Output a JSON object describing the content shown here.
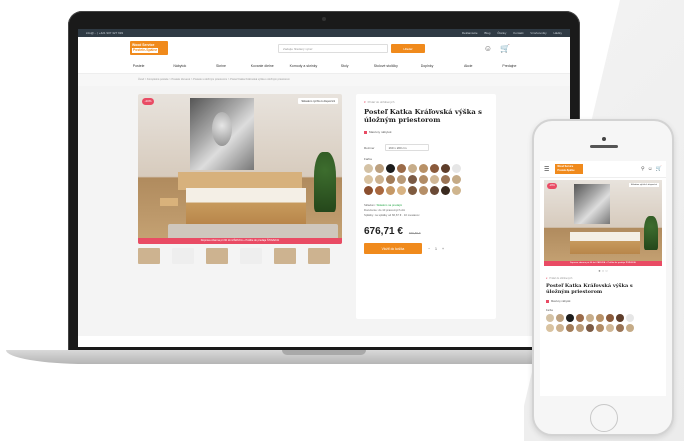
{
  "site": {
    "topbar_contact": "info@... | +421 907 327 693",
    "topbar_links": [
      "Reklamácie",
      "Blog",
      "Články",
      "Kontakt",
      "Vzorkovníky",
      "Hádky"
    ],
    "logo_top": "Wood Service",
    "logo_bottom": "Postele-Spálne",
    "search_placeholder": "Zadajte hľadaný výraz",
    "search_button": "Hľadať",
    "nav": [
      "Postele",
      "Nábytok",
      "Skrine",
      "Kovanie dielne",
      "Komody a skrinky",
      "Stoly",
      "Stolové stoličky",
      "Doplnky",
      "Akcie",
      "Predajne"
    ],
    "breadcrumb": "Úvod > Kompletné postele > Postele drevené > Postele s úložným priestorom > Posteľ Katka Kráľovská výška s úložným priestorom",
    "discount": "-20%",
    "fast_badge": "Skladom rýchlo k dispozícii",
    "promo": "Doprava zdarma pri 60 dní ZÁRUKA + Pošlite do predaja ŠTAVEKA!"
  },
  "product": {
    "favorite_text": "Pridať do obľúbených",
    "title": "Posteľ Katka Kráľovská výška s úložným priestorom",
    "brand": "Masívny nábytok",
    "size_label": "Rozmer",
    "size_value": "160 x 200 cm",
    "color_label": "Farba",
    "swatches": [
      "#d4c2a5",
      "#bca07f",
      "#1b1b1b",
      "#9b6b49",
      "#c7ad8a",
      "#b89167",
      "#8a5a3b",
      "#5e3d2a",
      "#e6e6e6",
      "#d9c3a1",
      "#cdb28f",
      "#a27c58",
      "#b99a77",
      "#7b5a44",
      "#b18c66",
      "#d0b796",
      "#9a7455",
      "#c5ab87",
      "#8b4f2f",
      "#a9683f",
      "#c59866",
      "#d8b383",
      "#7f5b3f",
      "#b58f68",
      "#6b4a36",
      "#3a2a1f",
      "#cfb58e"
    ],
    "availability_label": "Skladom",
    "availability_value": "Skladom na predajni",
    "delivery_label": "Doručenie",
    "delivery_value": "do 10 pracovných dní",
    "installment_label": "Splátky",
    "installment_value": "na splátky od 66,67 €",
    "installment_note": "10 mesiacov",
    "price": "676,71 €",
    "old_price": "845,89 €",
    "cart_button": "Vložiť do košíka",
    "qty_minus": "−",
    "qty_value": "1",
    "qty_plus": "+"
  },
  "phone": {
    "menu_icon": "☰",
    "dots": "● ○ ○",
    "colors_label": "Farba",
    "swatches": [
      "#d4c2a5",
      "#bca07f",
      "#1b1b1b",
      "#9b6b49",
      "#c7ad8a",
      "#b89167",
      "#8a5a3b",
      "#5e3d2a",
      "#e6e6e6",
      "#d9c3a1",
      "#cdb28f",
      "#a27c58",
      "#b99a77",
      "#7b5a44",
      "#b18c66",
      "#d0b796",
      "#9a7455",
      "#c5ab87"
    ]
  },
  "colors": {
    "brand_orange": "#f08a1c",
    "promo_pink": "#e94b64"
  }
}
